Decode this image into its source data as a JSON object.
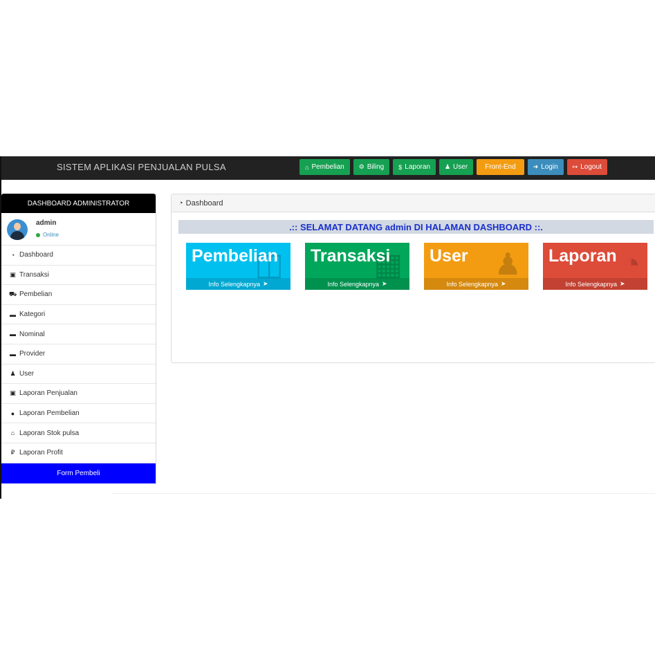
{
  "navbar": {
    "brand": "SISTEM APLIKASI PENJUALAN PULSA",
    "buttons": [
      {
        "icon": "home-icon",
        "glyph": "⌂",
        "label": "Pembelian",
        "color": "#16a052"
      },
      {
        "icon": "cogs-icon",
        "glyph": "⚙",
        "label": "Biling",
        "color": "#16a052"
      },
      {
        "icon": "dollar-icon",
        "glyph": "$",
        "label": "Laporan",
        "color": "#16a052"
      },
      {
        "icon": "user-icon",
        "glyph": "♟",
        "label": "User",
        "color": "#16a052"
      },
      {
        "icon": "",
        "glyph": "",
        "label": "Front-End",
        "color": "#f39c12"
      },
      {
        "icon": "sign-in-icon",
        "glyph": "➜",
        "label": "Login",
        "color": "#3c8dbc"
      },
      {
        "icon": "sign-out-icon",
        "glyph": "↦",
        "label": "Logout",
        "color": "#dd4b39"
      }
    ]
  },
  "sidebar": {
    "header": "DASHBOARD ADMINISTRATOR",
    "user": {
      "name": "admin",
      "status": "Online"
    },
    "items": [
      {
        "icon": "dashboard-icon",
        "glyph": "◔",
        "label": "Dashboard"
      },
      {
        "icon": "money-icon",
        "glyph": "▣",
        "label": "Transaksi"
      },
      {
        "icon": "cart-icon",
        "glyph": "⛟",
        "label": "Pembelian"
      },
      {
        "icon": "folder-icon",
        "glyph": "▬",
        "label": "Kategori"
      },
      {
        "icon": "folder-icon",
        "glyph": "▬",
        "label": "Nominal"
      },
      {
        "icon": "folder-icon",
        "glyph": "▬",
        "label": "Provider"
      },
      {
        "icon": "user-secret-icon",
        "glyph": "♟",
        "label": "User"
      },
      {
        "icon": "money-icon",
        "glyph": "▣",
        "label": "Laporan Penjualan"
      },
      {
        "icon": "circle-icon",
        "glyph": "●",
        "label": "Laporan Pembelian"
      },
      {
        "icon": "bank-icon",
        "glyph": "⌂",
        "label": "Laporan Stok pulsa"
      },
      {
        "icon": "ruble-icon",
        "glyph": "₽",
        "label": "Laporan Profit"
      }
    ],
    "form_button": "Form Pembeli"
  },
  "main": {
    "panel_title": "Dashboard",
    "welcome": ".:: SELAMAT DATANG admin DI HALAMAN DASHBOARD ::.",
    "tiles": [
      {
        "title": "Pembelian",
        "footer": "Info Selengkapnya",
        "color": "#00c0ef",
        "deco_icon": "shopping-bag-icon"
      },
      {
        "title": "Transaksi",
        "footer": "Info Selengkapnya",
        "color": "#00a65a",
        "deco_icon": "bar-chart-icon"
      },
      {
        "title": "User",
        "footer": "Info Selengkapnya",
        "color": "#f39c12",
        "deco_icon": "user-plus-icon"
      },
      {
        "title": "Laporan",
        "footer": "Info Selengkapnya",
        "color": "#dd4b39",
        "deco_icon": "pie-chart-icon"
      }
    ]
  }
}
